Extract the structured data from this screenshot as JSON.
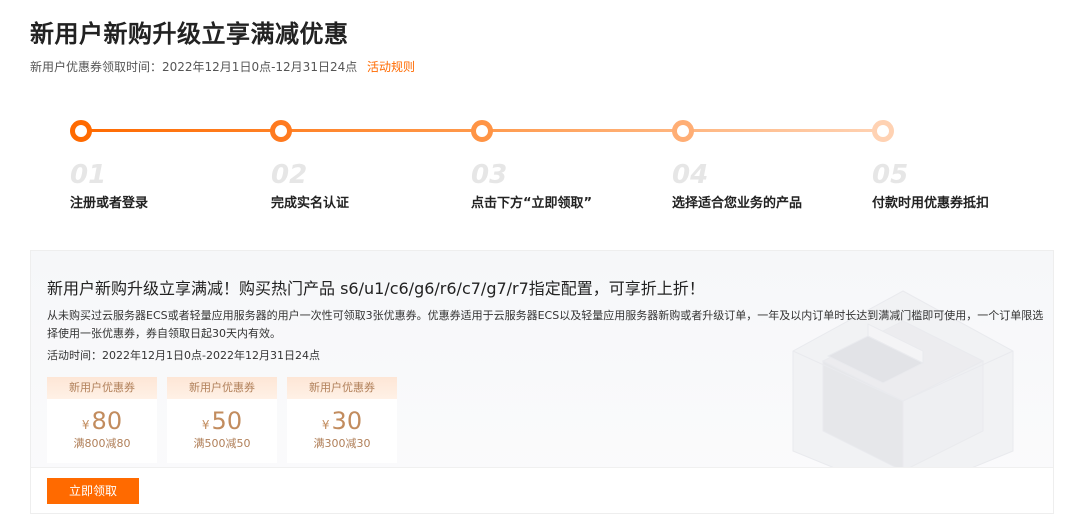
{
  "header": {
    "title": "新用户新购升级立享满减优惠",
    "period": "新用户优惠券领取时间：2022年12月1日0点-12月31日24点",
    "rules_link": "活动规则"
  },
  "steps": [
    {
      "num": "01",
      "label": "注册或者登录"
    },
    {
      "num": "02",
      "label": "完成实名认证"
    },
    {
      "num": "03",
      "label": "点击下方“立即领取”"
    },
    {
      "num": "04",
      "label": "选择适合您业务的产品"
    },
    {
      "num": "05",
      "label": "付款时用优惠券抵扣"
    }
  ],
  "colors": {
    "accent": "#ff6a00",
    "coupon_text": "#c28c5e"
  },
  "promo": {
    "title": "新用户新购升级立享满减！购买热门产品 s6/u1/c6/g6/r6/c7/g7/r7指定配置，可享折上折！",
    "description": "从未购买过云服务器ECS或者轻量应用服务器的用户一次性可领取3张优惠券。优惠券适用于云服务器ECS以及轻量应用服务器新购或者升级订单，一年及以内订单时长达到满减门槛即可使用，一个订单限选择使用一张优惠券，券自领取日起30天内有效。",
    "time": "活动时间：2022年12月1日0点-2022年12月31日24点",
    "coupons": [
      {
        "header": "新用户优惠券",
        "currency": "¥",
        "amount": "80",
        "condition": "满800减80"
      },
      {
        "header": "新用户优惠券",
        "currency": "¥",
        "amount": "50",
        "condition": "满500减50"
      },
      {
        "header": "新用户优惠券",
        "currency": "¥",
        "amount": "30",
        "condition": "满300减30"
      }
    ],
    "claim_button": "立即领取"
  }
}
